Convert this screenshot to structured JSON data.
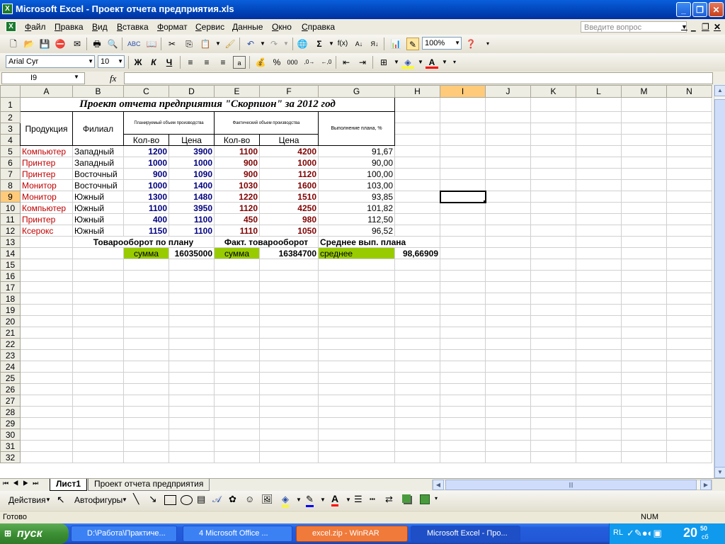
{
  "window": {
    "title": "Microsoft Excel - Проект отчета предприятия.xls",
    "app_icon": "X"
  },
  "menu": [
    "Файл",
    "Правка",
    "Вид",
    "Вставка",
    "Формат",
    "Сервис",
    "Данные",
    "Окно",
    "Справка"
  ],
  "ask_placeholder": "Введите вопрос",
  "toolbar": {
    "zoom": "100%",
    "font_name": "Arial Cyr",
    "font_size": "10",
    "bold": "Ж",
    "italic": "К",
    "underline": "Ч",
    "currency": "%"
  },
  "formula_bar": {
    "name_box": "I9",
    "fx": "fx"
  },
  "columns": [
    "A",
    "B",
    "C",
    "D",
    "E",
    "F",
    "G",
    "H",
    "I",
    "J",
    "K",
    "L",
    "M",
    "N"
  ],
  "selected_cell": "I9",
  "sheet": {
    "title": "Проект отчета предприятия \"Скорпион\" за 2012 год",
    "col_product": "Продукция",
    "col_branch": "Филиал",
    "col_planned": "Планируемый объем производства",
    "col_actual": "Фактический объем производства",
    "col_percent": "Выполнение плана, %",
    "qty": "Кол-во",
    "price": "Цена",
    "rows": [
      {
        "product": "Компьютер",
        "branch": "Западный",
        "pq": "1200",
        "pp": "3900",
        "aq": "1100",
        "ap": "4200",
        "pct": "91,67"
      },
      {
        "product": "Принтер",
        "branch": "Западный",
        "pq": "1000",
        "pp": "1000",
        "aq": "900",
        "ap": "1000",
        "pct": "90,00"
      },
      {
        "product": "Принтер",
        "branch": "Восточный",
        "pq": "900",
        "pp": "1090",
        "aq": "900",
        "ap": "1120",
        "pct": "100,00"
      },
      {
        "product": "Монитор",
        "branch": "Восточный",
        "pq": "1000",
        "pp": "1400",
        "aq": "1030",
        "ap": "1600",
        "pct": "103,00"
      },
      {
        "product": "Монитор",
        "branch": "Южный",
        "pq": "1300",
        "pp": "1480",
        "aq": "1220",
        "ap": "1510",
        "pct": "93,85"
      },
      {
        "product": "Компьютер",
        "branch": "Южный",
        "pq": "1100",
        "pp": "3950",
        "aq": "1120",
        "ap": "4250",
        "pct": "101,82"
      },
      {
        "product": "Принтер",
        "branch": "Южный",
        "pq": "400",
        "pp": "1100",
        "aq": "450",
        "ap": "980",
        "pct": "112,50"
      },
      {
        "product": "Ксерокс",
        "branch": "Южный",
        "pq": "1150",
        "pp": "1100",
        "aq": "1110",
        "ap": "1050",
        "pct": "96,52"
      }
    ],
    "turnover_plan_label": "Товарооборот по плану",
    "turnover_fact_label": "Факт. товарооборот",
    "avg_label": "Среднее вып. плана",
    "sum1_label": "сумма",
    "sum1_value": "16035000",
    "sum2_label": "сумма",
    "sum2_value": "16384700",
    "avg_text": "среднее",
    "avg_value": "98,66909"
  },
  "sheet_tabs": [
    "Лист1",
    "Проект отчета предприятия"
  ],
  "drawing": {
    "actions": "Действия",
    "autoshapes": "Автофигуры"
  },
  "status": {
    "left": "Готово",
    "num": "NUM"
  },
  "taskbar": {
    "start": "пуск",
    "tasks": [
      "D:\\Работа\\Практиче...",
      "4 Microsoft Office ...",
      "excel.zip - WinRAR",
      "Microsoft Excel - Про..."
    ],
    "lang": "RL",
    "time": "20",
    "time_min": "50",
    "time_day": "сб"
  }
}
